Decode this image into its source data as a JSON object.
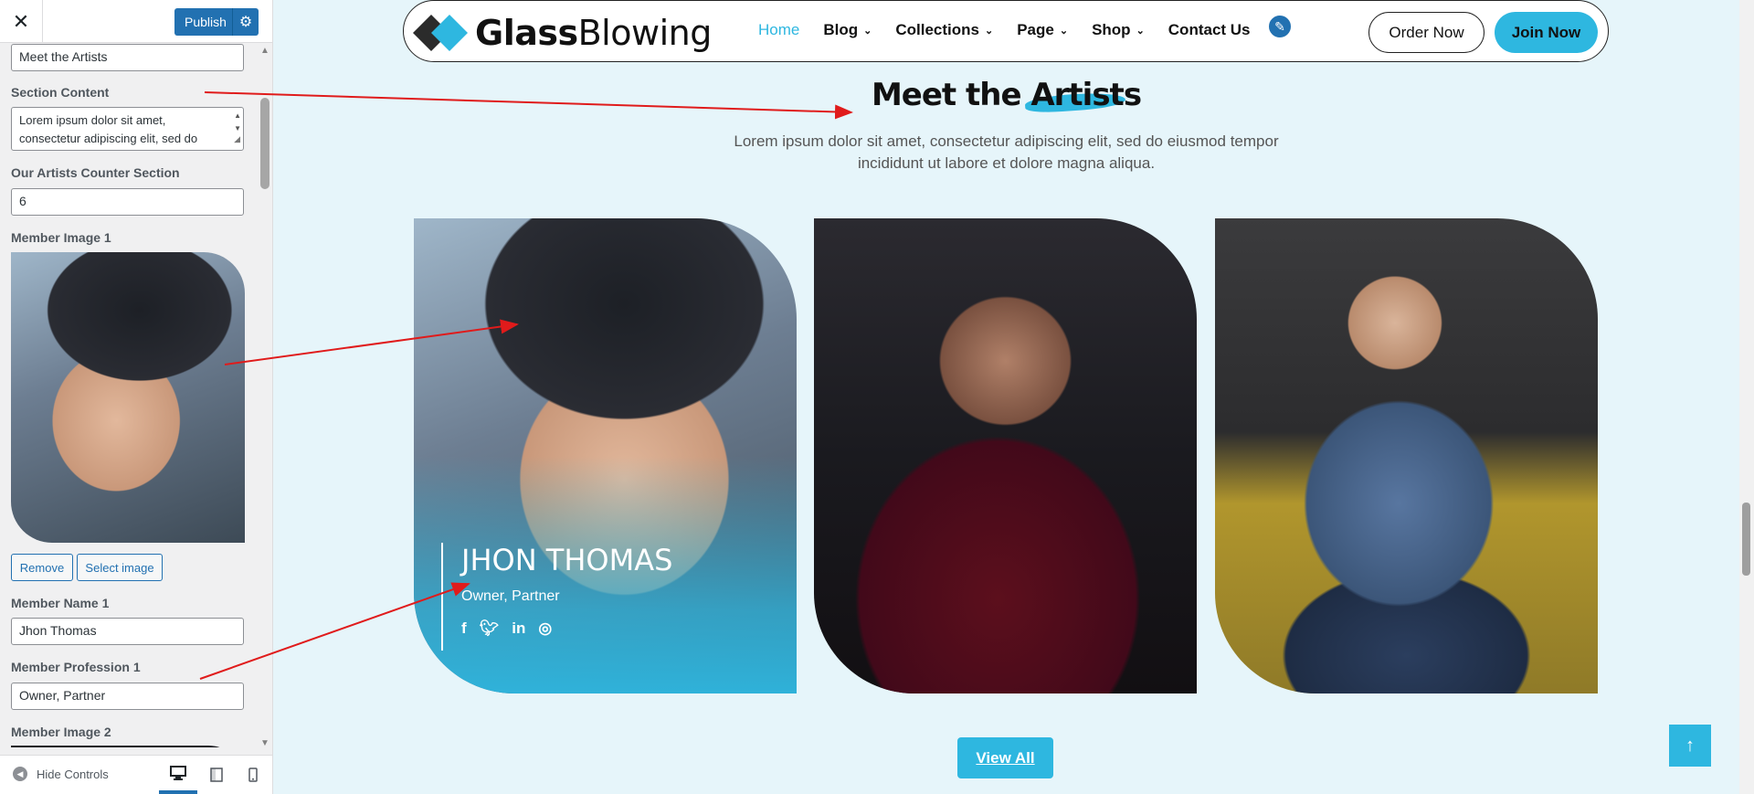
{
  "customizer": {
    "close_icon": "close-icon",
    "publish_label": "Publish",
    "fields": {
      "section_title_value": "Meet the Artists",
      "section_content_label": "Section Content",
      "section_content_value": "Lorem ipsum dolor sit amet, consectetur adipiscing elit, sed do",
      "counter_label": "Our Artists Counter Section",
      "counter_value": "6",
      "member_image1_label": "Member Image 1",
      "remove_label": "Remove",
      "select_image_label": "Select image",
      "member_name1_label": "Member Name 1",
      "member_name1_value": "Jhon Thomas",
      "member_profession1_label": "Member Profession 1",
      "member_profession1_value": "Owner, Partner",
      "member_image2_label": "Member Image 2"
    },
    "footer": {
      "hide_controls_label": "Hide Controls"
    }
  },
  "site": {
    "logo": {
      "bold": "Glass",
      "light": "Blowing"
    },
    "nav": [
      {
        "label": "Home",
        "active": true,
        "has_dropdown": false
      },
      {
        "label": "Blog",
        "active": false,
        "has_dropdown": true
      },
      {
        "label": "Collections",
        "active": false,
        "has_dropdown": true
      },
      {
        "label": "Page",
        "active": false,
        "has_dropdown": true
      },
      {
        "label": "Shop",
        "active": false,
        "has_dropdown": true
      },
      {
        "label": "Contact Us",
        "active": false,
        "has_dropdown": false
      }
    ],
    "order_now_label": "Order Now",
    "join_now_label": "Join Now",
    "accent_color": "#2eb7e0"
  },
  "section": {
    "title": "Meet the Artists",
    "description": "Lorem ipsum dolor sit amet, consectetur adipiscing elit, sed do eiusmod tempor incididunt ut labore et dolore magna aliqua.",
    "members": [
      {
        "name": "JHON THOMAS",
        "profession": "Owner, Partner",
        "socials": [
          "facebook-icon",
          "twitter-icon",
          "linkedin-icon",
          "instagram-icon"
        ]
      },
      {
        "name": "",
        "profession": ""
      },
      {
        "name": "",
        "profession": ""
      }
    ],
    "view_all_label": "View All"
  }
}
